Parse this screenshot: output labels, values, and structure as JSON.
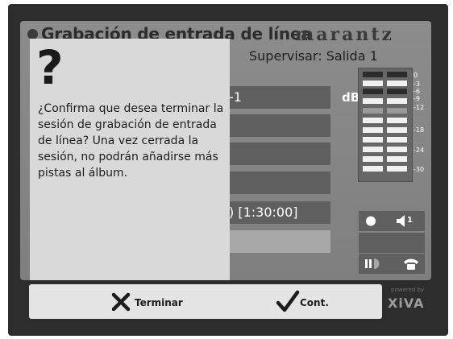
{
  "header": {
    "title": "Grabación de entrada de línea",
    "brand": "marantz",
    "monitor": "Supervisar: Salida 1"
  },
  "rows": [
    {
      "text": "-1"
    },
    {
      "text": ""
    },
    {
      "text": ""
    },
    {
      "text": ""
    },
    {
      "text": ") [1:30:00]"
    },
    {
      "text": ""
    }
  ],
  "meter": {
    "unit": "dB",
    "scale": [
      "0",
      "-3",
      "-6",
      "-9",
      "-12",
      "-18",
      "-24",
      "-30"
    ]
  },
  "status": {
    "speaker_number": "1"
  },
  "dialog": {
    "symbol": "?",
    "message": "¿Confirma que desea terminar la sesión de grabación de entrada de línea? Una vez cerrada la sesión, no podrán añadirse más pistas al álbum."
  },
  "buttons": {
    "terminate": "Terminar",
    "continue": "Cont."
  },
  "logo": {
    "prefix": "powered by",
    "name": "XiVA"
  },
  "colors": {
    "frame": "#2d2d2d",
    "panel": "#8c8c8c",
    "dialog": "#d9d9d9",
    "row": "#5f5f5f",
    "button_bar": "#e4e4e4"
  }
}
